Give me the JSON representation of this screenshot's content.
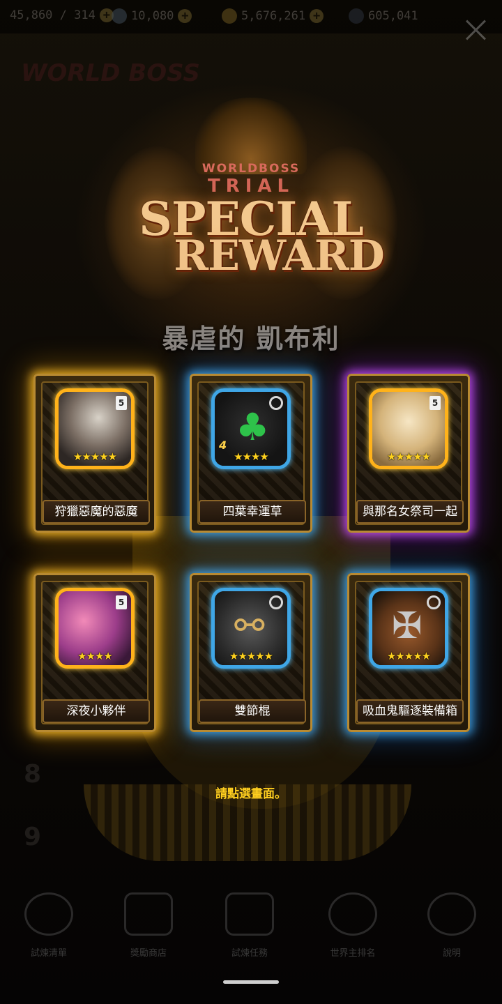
{
  "resources": [
    {
      "value": "45,860 / 314"
    },
    {
      "value": "10,080"
    },
    {
      "value": "5,676,261"
    },
    {
      "value": "605,041"
    }
  ],
  "emblem": {
    "top_text": "WORLDBOSS",
    "trial_text": "TRIAL",
    "line1": "SPECIAL",
    "line2": "REWARD"
  },
  "boss_name": "暴虐的 凱布利",
  "cards": [
    {
      "label": "狩獵惡魔的惡魔",
      "stars": "★★★★★",
      "glow": "gold",
      "badge": "5"
    },
    {
      "label": "四葉幸運草",
      "stars": "★★★★",
      "glow": "blue",
      "level": "4"
    },
    {
      "label": "與那名女祭司一起",
      "stars": "★★★★★",
      "glow": "purple",
      "badge": "5"
    },
    {
      "label": "深夜小夥伴",
      "stars": "★★★★",
      "glow": "gold",
      "badge": "5"
    },
    {
      "label": "雙節棍",
      "stars": "★★★★★",
      "glow": "blue"
    },
    {
      "label": "吸血鬼驅逐裝備箱",
      "stars": "★★★★★",
      "glow": "blue"
    }
  ],
  "tap_hint": "請點選畫面。",
  "bottom_nav": [
    {
      "label": "試煉清單",
      "icon": "world-boss-icon"
    },
    {
      "label": "獎勵商店",
      "icon": "gift-icon"
    },
    {
      "label": "試煉任務",
      "icon": "mission-icon"
    },
    {
      "label": "世界主排名",
      "icon": "ranking-icon"
    },
    {
      "label": "說明",
      "icon": "info-icon"
    }
  ],
  "colors": {
    "title_gold": "#f3c88e",
    "hint_yellow": "#ffcf1f",
    "star_yellow": "#ffd21f",
    "glow_gold": "#ffbe28",
    "glow_blue": "#46b4ff",
    "glow_purple": "#c850ff"
  }
}
